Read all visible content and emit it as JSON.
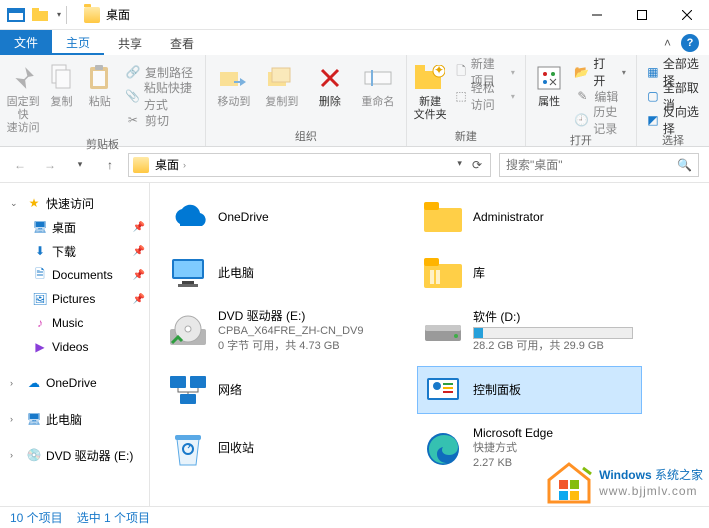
{
  "window": {
    "title": "桌面"
  },
  "tabs": {
    "file": "文件",
    "home": "主页",
    "share": "共享",
    "view": "查看"
  },
  "ribbon": {
    "clipboard": {
      "pin": "固定到快\n速访问",
      "copy": "复制",
      "paste": "粘贴",
      "copy_path": "复制路径",
      "paste_shortcut": "粘贴快捷方式",
      "cut": "剪切",
      "label": "剪贴板"
    },
    "organize": {
      "move_to": "移动到",
      "copy_to": "复制到",
      "delete": "删除",
      "rename": "重命名",
      "label": "组织"
    },
    "new": {
      "new_folder": "新建\n文件夹",
      "new_item": "新建项目",
      "easy_access": "轻松访问",
      "label": "新建"
    },
    "open": {
      "properties": "属性",
      "open": "打开",
      "edit": "编辑",
      "history": "历史记录",
      "label": "打开"
    },
    "select": {
      "select_all": "全部选择",
      "select_none": "全部取消",
      "invert": "反向选择",
      "label": "选择"
    }
  },
  "nav": {
    "crumb": "桌面",
    "search_placeholder": "搜索\"桌面\""
  },
  "tree": {
    "quick_access": "快速访问",
    "items": [
      {
        "label": "桌面",
        "pinned": true
      },
      {
        "label": "下载",
        "pinned": true
      },
      {
        "label": "Documents",
        "pinned": true
      },
      {
        "label": "Pictures",
        "pinned": true
      },
      {
        "label": "Music",
        "pinned": false
      },
      {
        "label": "Videos",
        "pinned": false
      }
    ],
    "onedrive": "OneDrive",
    "this_pc": "此电脑",
    "dvd": "DVD 驱动器 (E:)"
  },
  "items": {
    "onedrive": {
      "name": "OneDrive"
    },
    "this_pc": {
      "name": "此电脑"
    },
    "dvd": {
      "name": "DVD 驱动器 (E:)",
      "sub1": "CPBA_X64FRE_ZH-CN_DV9",
      "sub2": "0 字节 可用，共 4.73 GB"
    },
    "network": {
      "name": "网络"
    },
    "recycle": {
      "name": "回收站"
    },
    "admin": {
      "name": "Administrator"
    },
    "library": {
      "name": "库"
    },
    "soft_d": {
      "name": "软件 (D:)",
      "free": "28.2 GB 可用，共 29.9 GB",
      "fill_pct": 6
    },
    "control": {
      "name": "控制面板"
    },
    "edge": {
      "name": "Microsoft Edge",
      "sub1": "快捷方式",
      "sub2": "2.27 KB"
    }
  },
  "status": {
    "count": "10 个项目",
    "selected": "选中 1 个项目"
  },
  "watermark": {
    "brand_a": "Windows",
    "brand_b": " 系统之家",
    "url": "www.bjjmlv.com"
  }
}
